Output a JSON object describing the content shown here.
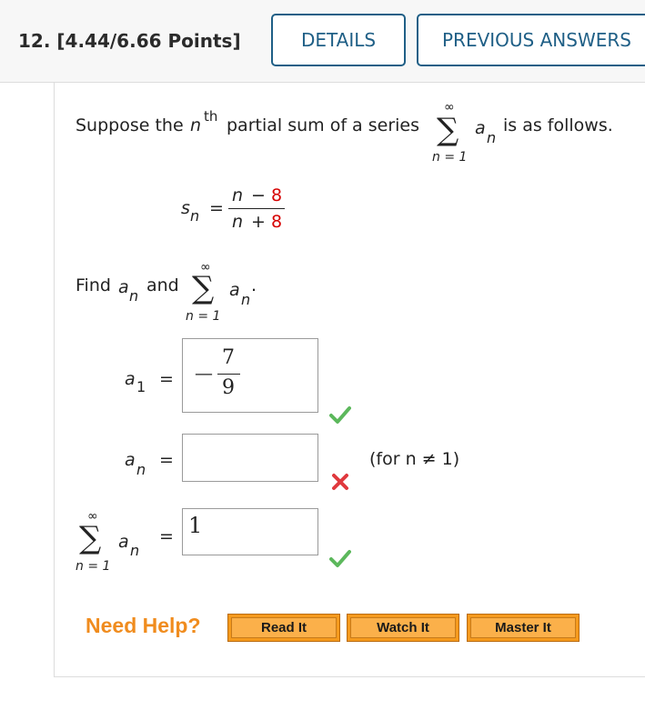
{
  "header": {
    "question_title": "12. [4.44/6.66 Points]",
    "details_label": "DETAILS",
    "previous_answers_label": "PREVIOUS ANSWERS"
  },
  "problem": {
    "intro_prefix": "Suppose the",
    "intro_n": "n",
    "intro_sup": "th",
    "intro_mid": "partial sum of a series",
    "intro_suffix": "is as follows.",
    "sum_symbol": "∑",
    "sum_upper": "∞",
    "sum_lower": "n = 1",
    "term_a": "a",
    "term_sub": "n",
    "sn_s": "s",
    "sn_sub": "n",
    "equals": "=",
    "sn_num_var": "n",
    "sn_num_op": "−",
    "sn_num_const": "8",
    "sn_den_var": "n",
    "sn_den_op": "+",
    "sn_den_const": "8",
    "find_prefix": "Find",
    "find_and": "and",
    "period": "."
  },
  "answers": {
    "a1_label_a": "a",
    "a1_label_sub": "1",
    "a1_minus": "—",
    "a1_num": "7",
    "a1_den": "9",
    "an_label_a": "a",
    "an_label_sub": "n",
    "an_value": "",
    "an_note": "(for n ≠ 1)",
    "sum_value": "1"
  },
  "help": {
    "need_help": "Need Help?",
    "read_it": "Read It",
    "watch_it": "Watch It",
    "master_it": "Master It"
  },
  "colors": {
    "accent": "#1f5f86",
    "correct": "#5cb85c",
    "incorrect": "#e0393e",
    "help_orange": "#f59a1d",
    "red_const": "#d60000"
  }
}
